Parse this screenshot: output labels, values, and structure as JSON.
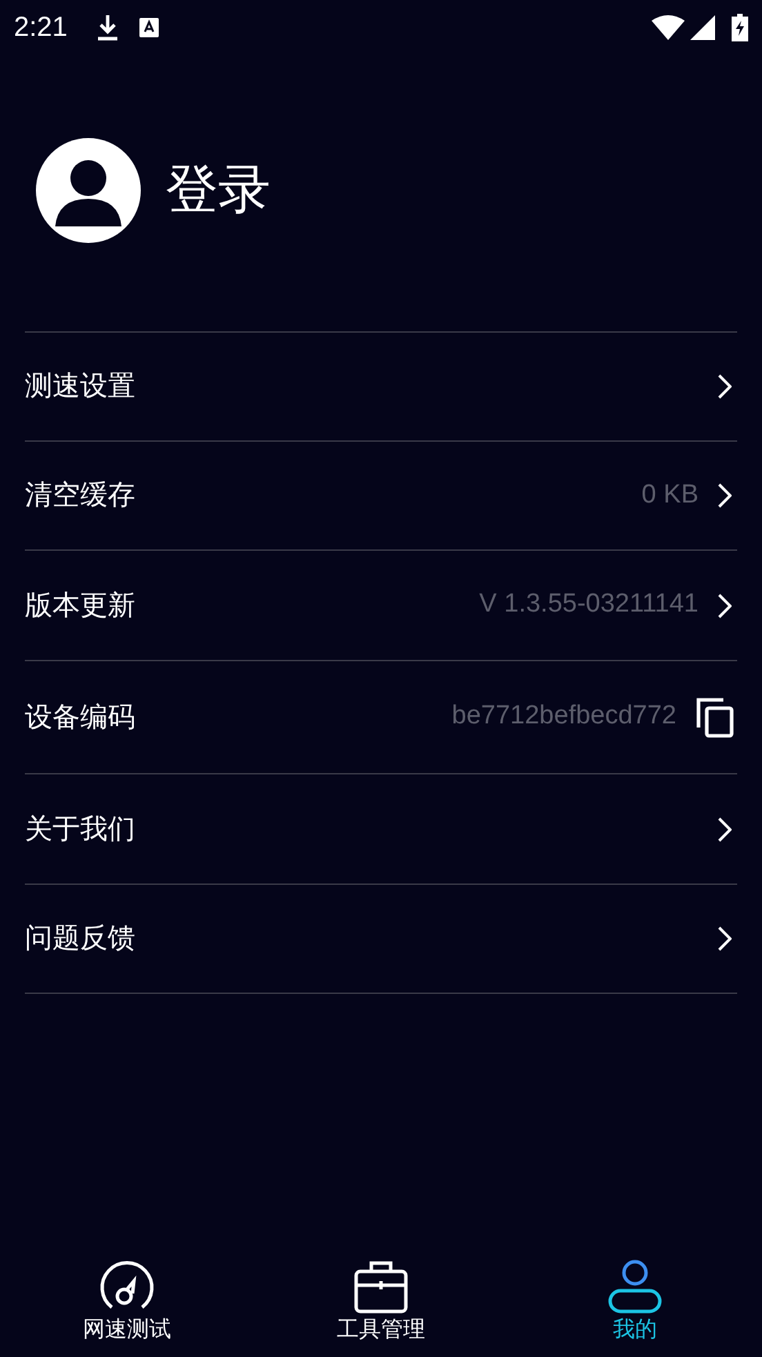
{
  "status_bar": {
    "time": "2:21"
  },
  "profile": {
    "login_label": "登录"
  },
  "settings": [
    {
      "label": "测速设置",
      "kind": "chevron"
    },
    {
      "label": "清空缓存",
      "value": "0 KB",
      "kind": "chevron"
    },
    {
      "label": "版本更新",
      "value": "V 1.3.55-03211141",
      "kind": "chevron"
    },
    {
      "label": "设备编码",
      "value": "be7712befbecd772",
      "kind": "copy"
    },
    {
      "label": "关于我们",
      "kind": "chevron"
    },
    {
      "label": "问题反馈",
      "kind": "chevron"
    }
  ],
  "bottom_nav": [
    {
      "label": "网速测试",
      "kind": "speed",
      "selected": false
    },
    {
      "label": "工具管理",
      "kind": "toolbox",
      "selected": false
    },
    {
      "label": "我的",
      "kind": "user",
      "selected": true
    }
  ]
}
